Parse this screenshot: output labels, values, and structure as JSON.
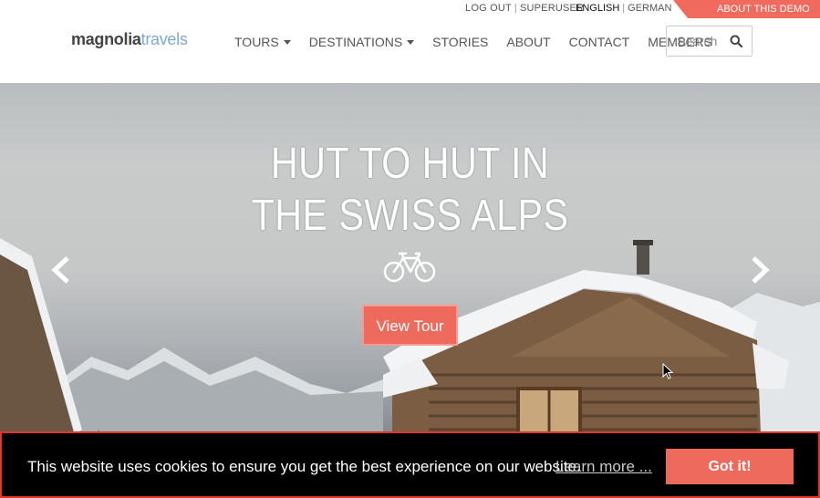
{
  "topbar": {
    "logout": "LOG OUT",
    "user": "SUPERUSER",
    "lang_active": "ENGLISH",
    "lang_other": "GERMAN",
    "about_demo": "ABOUT THIS DEMO",
    "separator": "|"
  },
  "header": {
    "logo_part1": "magnolia",
    "logo_part2": "travels",
    "nav": [
      {
        "label": "TOURS",
        "dropdown": true
      },
      {
        "label": "DESTINATIONS",
        "dropdown": true
      },
      {
        "label": "STORIES",
        "dropdown": false
      },
      {
        "label": "ABOUT",
        "dropdown": false
      },
      {
        "label": "CONTACT",
        "dropdown": false
      },
      {
        "label": "MEMBERS",
        "dropdown": false
      }
    ],
    "search_placeholder": "Search"
  },
  "hero": {
    "title_line1": "HUT TO HUT IN",
    "title_line2": "THE SWISS ALPS",
    "tour_icon": "bicycle-icon",
    "button": "View Tour"
  },
  "cookie": {
    "message": "This website uses cookies to ensure you get the best experience on our website.",
    "learn_more": "Learn more ...",
    "accept": "Got it!"
  },
  "colors": {
    "accent": "#ee6a5d",
    "logo_secondary": "#7fa8c9",
    "banner_bg": "#000000",
    "banner_border": "#e0362a"
  }
}
